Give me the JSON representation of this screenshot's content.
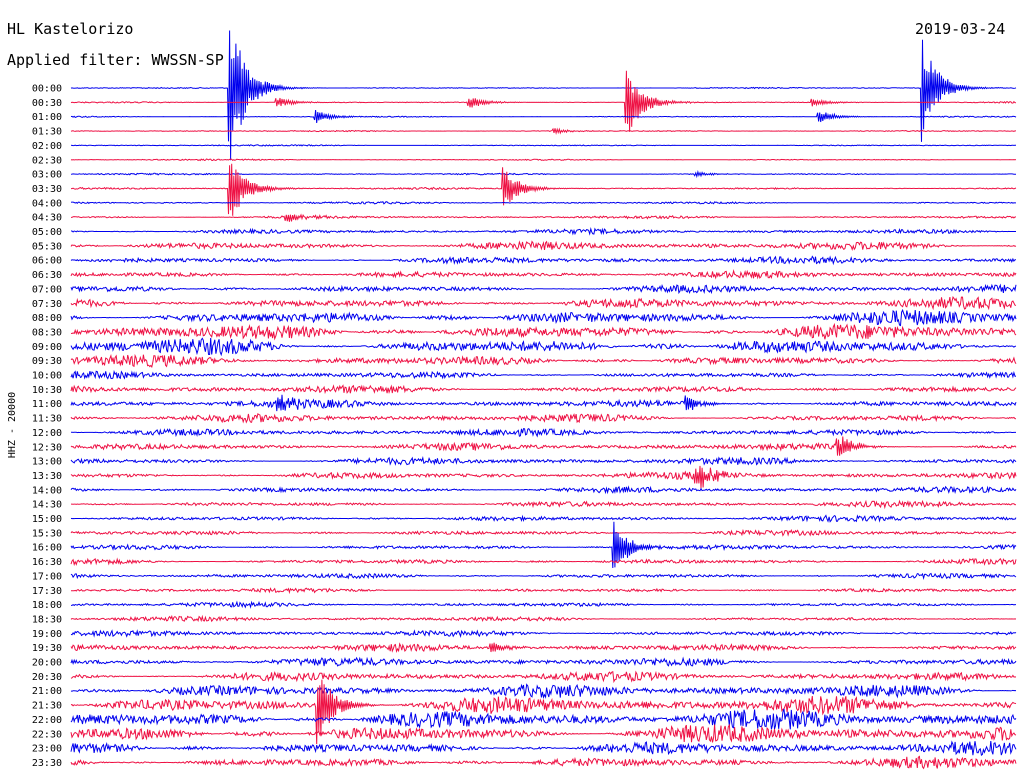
{
  "header": {
    "station": "HL Kastelorizo",
    "filter": "Applied filter: WWSSN-SP",
    "date": "2019-03-24"
  },
  "chart_data": {
    "type": "line",
    "title": "HL Kastelorizo",
    "subtitle": "Applied filter: WWSSN-SP",
    "date": "2019-03-24",
    "ylabel": "HHZ - 20000",
    "row_labels": [
      "00:00",
      "00:30",
      "01:00",
      "01:30",
      "02:00",
      "02:30",
      "03:00",
      "03:30",
      "04:00",
      "04:30",
      "05:00",
      "05:30",
      "06:00",
      "06:30",
      "07:00",
      "07:30",
      "08:00",
      "08:30",
      "09:00",
      "09:30",
      "10:00",
      "10:30",
      "11:00",
      "11:30",
      "12:00",
      "12:30",
      "13:00",
      "13:30",
      "14:00",
      "14:30",
      "15:00",
      "15:30",
      "16:00",
      "16:30",
      "17:00",
      "17:30",
      "18:00",
      "18:30",
      "19:00",
      "19:30",
      "20:00",
      "20:30",
      "21:00",
      "21:30",
      "22:00",
      "22:30",
      "23:00",
      "23:30"
    ],
    "colors": [
      "#0000ee",
      "#ee1144"
    ],
    "noise_level": [
      0.6,
      0.6,
      0.6,
      0.6,
      0.6,
      0.6,
      0.7,
      0.8,
      0.9,
      1.2,
      2.0,
      3.5,
      3.0,
      3.0,
      3.5,
      5.0,
      7.0,
      8.0,
      8.0,
      5.0,
      3.0,
      3.5,
      3.5,
      3.5,
      3.0,
      3.0,
      3.0,
      3.0,
      2.5,
      2.5,
      2.5,
      2.5,
      2.5,
      2.5,
      2.5,
      2.0,
      2.0,
      2.0,
      2.5,
      3.0,
      3.5,
      4.0,
      5.5,
      7.5,
      8.5,
      8.0,
      6.0,
      5.0
    ],
    "events": [
      {
        "row": 0,
        "minute": 5.0,
        "amplitude": 90
      },
      {
        "row": 0,
        "minute": 27.0,
        "amplitude": 55
      },
      {
        "row": 1,
        "minute": 6.5,
        "amplitude": 6
      },
      {
        "row": 1,
        "minute": 12.6,
        "amplitude": 7
      },
      {
        "row": 1,
        "minute": 17.6,
        "amplitude": 40
      },
      {
        "row": 1,
        "minute": 23.5,
        "amplitude": 5
      },
      {
        "row": 2,
        "minute": 7.7,
        "amplitude": 8
      },
      {
        "row": 2,
        "minute": 23.7,
        "amplitude": 8
      },
      {
        "row": 3,
        "minute": 15.3,
        "amplitude": 3
      },
      {
        "row": 6,
        "minute": 19.8,
        "amplitude": 3
      },
      {
        "row": 7,
        "minute": 5.0,
        "amplitude": 40
      },
      {
        "row": 7,
        "minute": 13.7,
        "amplitude": 25
      },
      {
        "row": 9,
        "minute": 6.8,
        "amplitude": 5
      },
      {
        "row": 22,
        "minute": 6.5,
        "amplitude": 10
      },
      {
        "row": 22,
        "minute": 19.5,
        "amplitude": 9
      },
      {
        "row": 25,
        "minute": 24.3,
        "amplitude": 14
      },
      {
        "row": 27,
        "minute": 19.8,
        "amplitude": 18
      },
      {
        "row": 32,
        "minute": 17.2,
        "amplitude": 30
      },
      {
        "row": 39,
        "minute": 13.3,
        "amplitude": 7
      },
      {
        "row": 43,
        "minute": 7.8,
        "amplitude": 45
      }
    ]
  }
}
